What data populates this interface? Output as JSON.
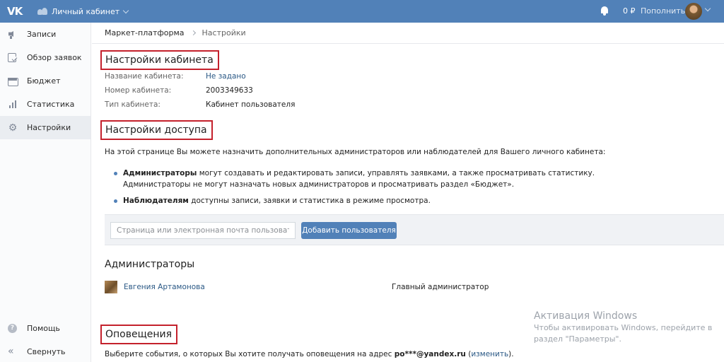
{
  "topbar": {
    "logo": "VK",
    "cabinet_label": "Личный кабинет",
    "balance": "0 ₽",
    "topup_label": "Пополнить",
    "icons": [
      "people-icon",
      "chevron-down-icon",
      "bell-icon",
      "avatar"
    ]
  },
  "sidebar": {
    "items": [
      {
        "label": "Записи",
        "icon": "megaphone-icon"
      },
      {
        "label": "Обзор заявок",
        "icon": "checklist-icon"
      },
      {
        "label": "Бюджет",
        "icon": "wallet-icon"
      },
      {
        "label": "Статистика",
        "icon": "bar-chart-icon"
      },
      {
        "label": "Настройки",
        "icon": "gear-icon",
        "active": true
      }
    ],
    "help_label": "Помощь",
    "collapse_label": "Свернуть"
  },
  "breadcrumbs": {
    "parent": "Маркет-платформа",
    "current": "Настройки"
  },
  "cabinet_settings": {
    "title": "Настройки кабинета",
    "name_label": "Название кабинета:",
    "name_value": "Не задано",
    "number_label": "Номер кабинета:",
    "number_value": "2003349633",
    "type_label": "Тип кабинета:",
    "type_value": "Кабинет пользователя"
  },
  "access_settings": {
    "title": "Настройки доступа",
    "description": "На этой странице Вы можете назначить дополнительных администраторов или наблюдателей для Вашего личного кабинета:",
    "bullet1_bold": "Администраторы",
    "bullet1_text": " могут создавать и редактировать записи, управлять заявками, а также просматривать статистику.",
    "bullet1_line2": "Администраторы не могут назначать новых администраторов и просматривать раздел «Бюджет».",
    "bullet2_bold": "Наблюдателям",
    "bullet2_text": " доступны записи, заявки и статистика в режиме просмотра.",
    "input_placeholder": "Страница или электронная почта пользователя",
    "add_button": "Добавить пользователя"
  },
  "admins": {
    "title": "Администраторы",
    "rows": [
      {
        "name": "Евгения Артамонова",
        "role": "Главный администратор"
      }
    ]
  },
  "notifications": {
    "title": "Оповещения",
    "text_prefix": "Выберите события, о которых Вы хотите получать оповещения на адрес ",
    "email": "po***@yandex.ru",
    "paren_open": " (",
    "change_link": "изменить",
    "paren_close": ")."
  },
  "watermark": {
    "title": "Активация Windows",
    "line1": "Чтобы активировать Windows, перейдите в",
    "line2": "раздел \"Параметры\"."
  },
  "colors": {
    "header": "#5181b8",
    "link": "#2a5885",
    "highlight_border": "#c4212c",
    "sidebar_bg": "#fafbfc"
  }
}
